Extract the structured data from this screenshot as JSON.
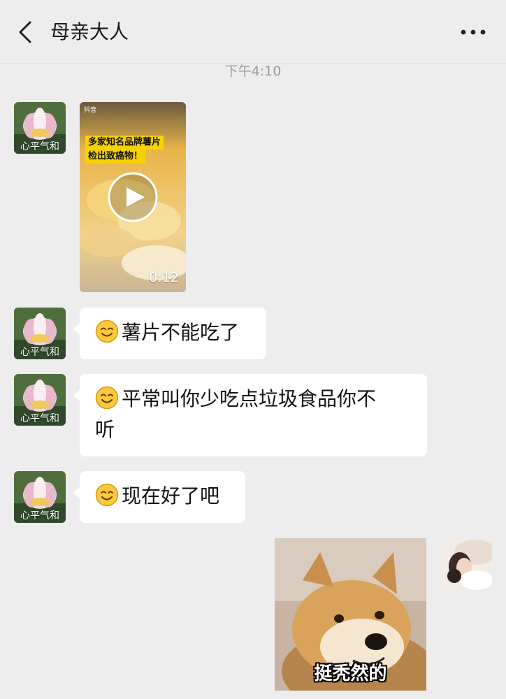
{
  "header": {
    "title": "母亲大人",
    "back_icon": "chevron-left-icon",
    "more_icon": "more-horizontal-icon"
  },
  "timestamp": "下午4:10",
  "contact": {
    "avatar_label": "心平气和"
  },
  "messages": [
    {
      "type": "video",
      "app_name": "抖音",
      "caption_line1": "多家知名品牌薯片",
      "caption_line2": "检出致癌物！",
      "duration": "0:12"
    },
    {
      "type": "text",
      "emoji": "smile-emoji-icon",
      "text": "薯片不能吃了"
    },
    {
      "type": "text",
      "emoji": "smile-emoji-icon",
      "line1": "平常叫你少吃点垃圾食品你不",
      "line2": "听"
    },
    {
      "type": "text",
      "emoji": "smile-emoji-icon",
      "text": "现在好了吧"
    },
    {
      "type": "sticker",
      "sender": "me",
      "caption": "挺秃然的"
    }
  ],
  "colors": {
    "background": "#ededed",
    "bubble": "#ffffff",
    "timestamp": "#9a9a9a"
  }
}
